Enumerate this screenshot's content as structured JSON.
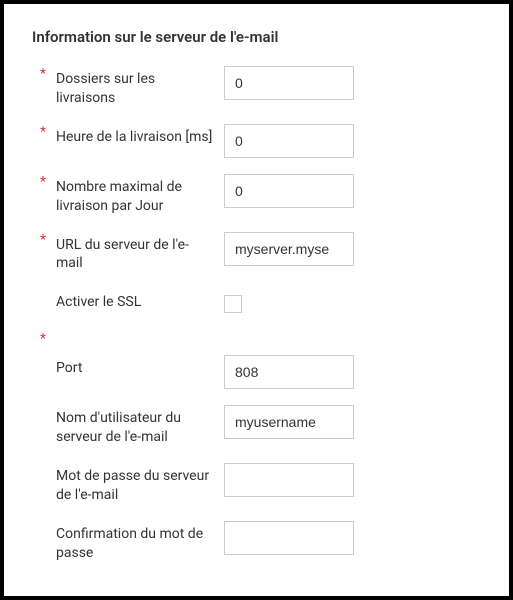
{
  "section": {
    "title": "Information sur le serveur de l'e-mail"
  },
  "fields": {
    "delivery_folders": {
      "label": "Dossiers sur les livraisons",
      "value": "0",
      "required": "*"
    },
    "delivery_time": {
      "label": "Heure de la livraison [ms]",
      "value": "0",
      "required": "*"
    },
    "max_delivery_per_day": {
      "label": "Nombre maximal de livraison par Jour",
      "value": "0",
      "required": "*"
    },
    "server_url": {
      "label": "URL du serveur de l'e-mail",
      "value": "myserver.myse",
      "required": "*"
    },
    "ssl": {
      "label": "Activer le SSL",
      "required": ""
    },
    "port": {
      "label": "Port",
      "value": "808",
      "required": "*"
    },
    "username": {
      "label": "Nom d'utilisateur du serveur de l'e-mail",
      "value": "myusername",
      "required": ""
    },
    "password": {
      "label": "Mot de passe du serveur de l'e-mail",
      "value": "",
      "required": ""
    },
    "password_confirm": {
      "label": "Confirmation du mot de passe",
      "value": "",
      "required": ""
    }
  }
}
